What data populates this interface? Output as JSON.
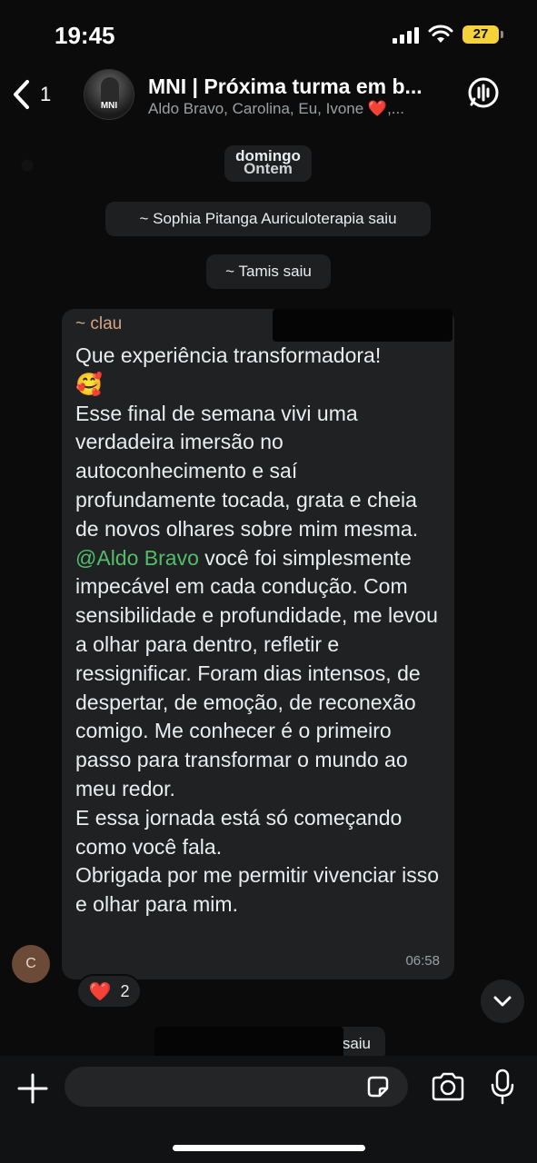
{
  "status_bar": {
    "time": "19:45",
    "battery": "27"
  },
  "header": {
    "back_count": "1",
    "avatar_text": "MNI",
    "title": "MNI | Próxima turma em b...",
    "subtitle": "Aldo Bravo, Carolina, Eu, Ivone ❤️,..."
  },
  "chat": {
    "day_label": "domingo",
    "day_label_behind": "Ontem",
    "system_messages": [
      "~ Sophia Pitanga Auriculoterapia saiu",
      "~ Tamis saiu",
      "saiu"
    ],
    "message": {
      "sender": "~ clau",
      "line1": "Que experiência transformadora!",
      "emoji": "🥰",
      "para1": "Esse final de semana vivi uma verdadeira imersão no autoconhecimento  e saí profundamente tocada, grata e cheia de novos olhares sobre mim mesma.",
      "mention": "@Aldo Bravo",
      "para2_after_mention": " você foi simplesmente impecável em cada condução. Com sensibilidade e profundidade, me  levou a olhar para dentro, refletir e ressignificar. Foram dias intensos, de despertar, de emoção, de reconexão comigo. Me conhecer é o primeiro passo para transformar o mundo ao meu redor.",
      "para3": "E essa jornada está só começando como você fala.",
      "para4": "Obrigada por me permitir vivenciar isso e olhar para mim.",
      "time": "06:58",
      "avatar_initial": "C",
      "reaction_emoji": "❤️",
      "reaction_count": "2"
    }
  },
  "composer": {
    "placeholder": ""
  }
}
